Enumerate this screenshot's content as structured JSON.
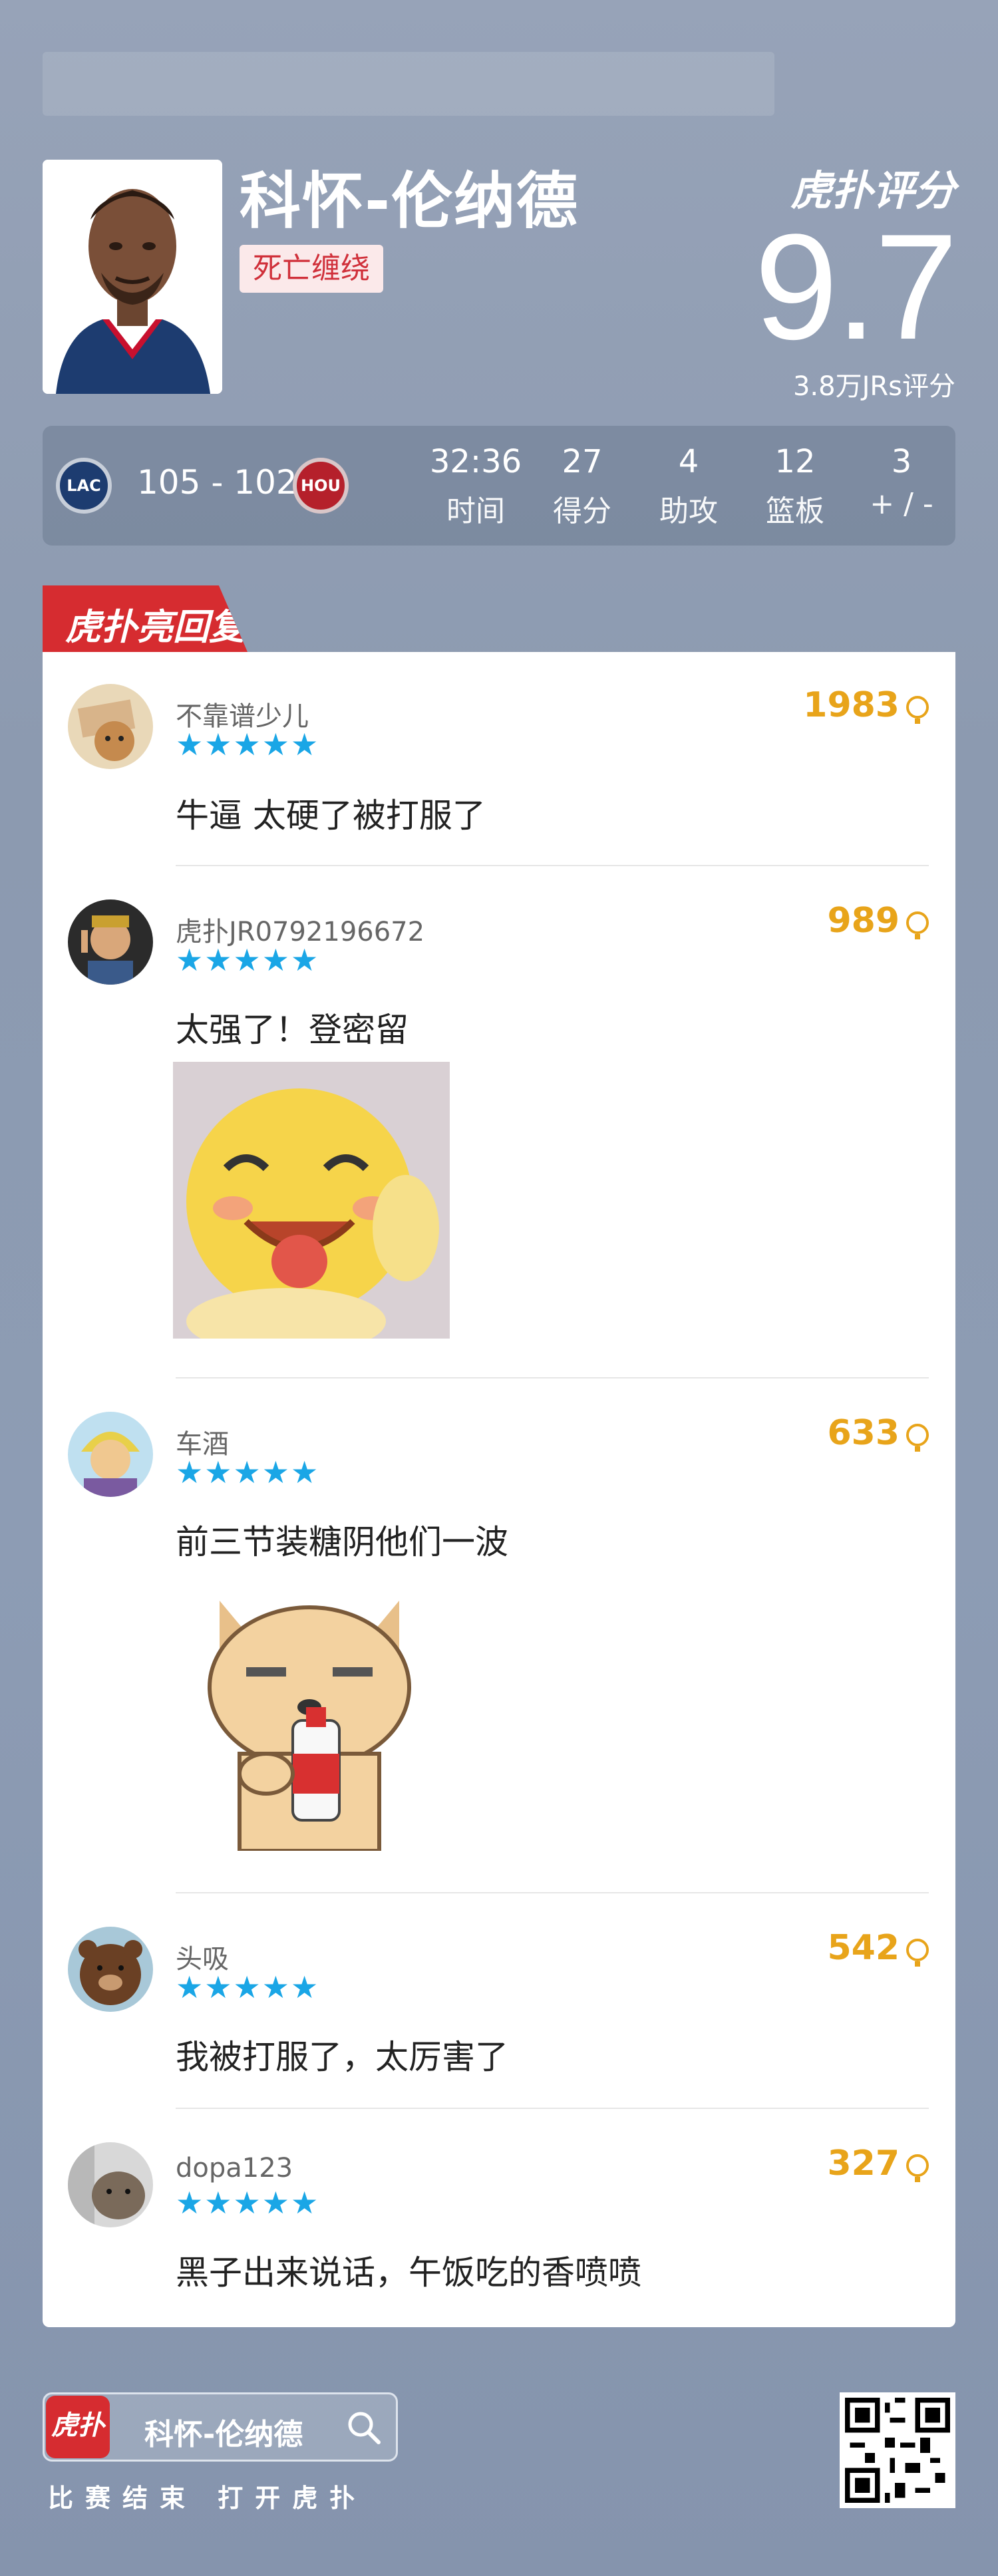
{
  "player": {
    "name": "科怀-伦纳德",
    "tag": "死亡缠绕"
  },
  "rating": {
    "brand": "虎扑评分",
    "score": "9.7",
    "count": "3.8万JRs评分"
  },
  "game": {
    "home_team": "LAC",
    "away_team": "HOU",
    "score": "105 - 102",
    "stats": [
      {
        "value": "32:36",
        "label": "时间"
      },
      {
        "value": "27",
        "label": "得分"
      },
      {
        "value": "4",
        "label": "助攻"
      },
      {
        "value": "12",
        "label": "篮板"
      },
      {
        "value": "3",
        "label": "+ / -"
      }
    ]
  },
  "section": {
    "title": "虎扑亮回复"
  },
  "comments": [
    {
      "user": "不靠谱少儿",
      "likes": "1983",
      "rating": 5,
      "text": "牛逼 太硬了被打服了"
    },
    {
      "user": "虎扑JR0792196672",
      "likes": "989",
      "rating": 5,
      "text": "太强了！登密留"
    },
    {
      "user": "车酒",
      "likes": "633",
      "rating": 5,
      "text": "前三节装糖阴他们一波"
    },
    {
      "user": "头吸",
      "likes": "542",
      "rating": 5,
      "text": "我被打服了，太厉害了"
    },
    {
      "user": "dopa123",
      "likes": "327",
      "rating": 5,
      "text": "黑子出来说话，午饭吃的香喷喷"
    }
  ],
  "stars": "★★★★★",
  "footer": {
    "app_icon_text": "虎扑",
    "search_text": "科怀-伦纳德",
    "cta": "比赛结束 打开虎扑"
  },
  "colors": {
    "accent_red": "#d62c30",
    "likes_gold": "#e8a41a",
    "star_blue": "#1aa6e6"
  }
}
